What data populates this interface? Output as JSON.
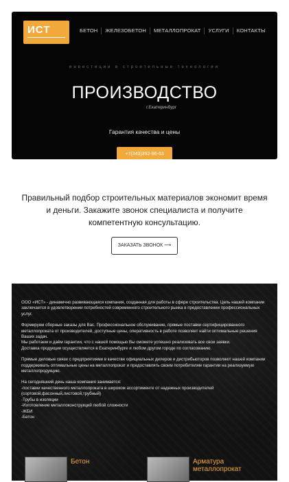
{
  "logo": {
    "text": "ИСТ"
  },
  "nav": [
    "Бетон",
    "Железобетон",
    "Металлопрокат",
    "Услуги",
    "Контакты"
  ],
  "hero": {
    "tagline": "инвестиции в строительные технологии",
    "title": "ПРОИЗВОДСТВО",
    "city": "г.Екатеринбург",
    "guarantee": "Гарантия качества и цены",
    "phone": "+7(343)392-96-63"
  },
  "pitch": {
    "text": "Правильный подбор строительных материалов экономит время и деньги. Закажите звонок специалиста и получите компетентную консультацию.",
    "button": "ЗАКАЗАТЬ ЗВОНОК ⟶"
  },
  "about": {
    "paragraphs": [
      "ООО «ИСТ» - динамично развивающаяся компания, созданная для работы в сфере строительства. Цель нашей компании заключается в удовлетворении потребностей современного строительного рынка в предоставлении профессиональных услуг.",
      "Формируем сборные заказы для Вас. Профессиональное обслуживание, прямые поставки сертифицированного металлопроката от производителей, доступные цены, оперативность в работе позволяет найти оптимальные решения Ваших задач.\nМы работаем и даём гарантии, что с нашей помощью Вы сможете успешно реализовать все свои заявки.\nДоставка продукции осуществляется в Екатеринбурге и любом другом городе по согласованию.",
      "Прямые деловые связи с предприятиями в качестве официальных дилеров и дистрибьюторов позволяют нашей компании поддерживать оптимальные цены на металлопрокат и предоставлять своим потребителям гарантии на реализуемую металлопродукцию.",
      "На сегодняшний день наша компания занимается:\n-поставки качественного металлопроката в широком ассортименте от надежных производителей (сортовой,фасонный,листовой,трубный)\n-Трубы в изоляции\n-Изготовление металлоконструкций любой сложности\n-ЖБИ\n-Бетон"
    ]
  },
  "cards": [
    {
      "title": "Бетон"
    },
    {
      "title": "Арматура металлопрокат"
    }
  ],
  "colors": {
    "accent": "#f2a93b",
    "hero_bg": "#050505"
  }
}
